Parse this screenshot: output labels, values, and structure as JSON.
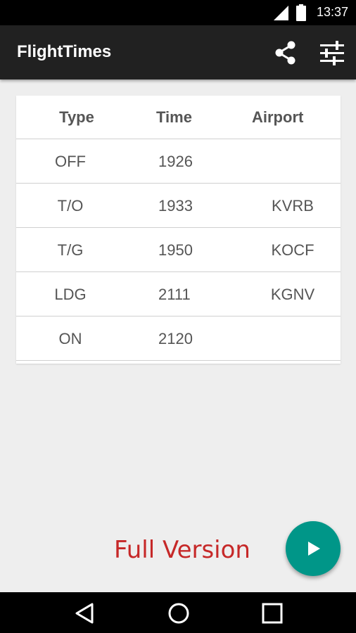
{
  "status_bar": {
    "time": "13:37"
  },
  "app_bar": {
    "title": "FlightTimes",
    "icons": [
      "share-icon",
      "tune-icon"
    ]
  },
  "table": {
    "headers": [
      "Type",
      "Time",
      "Airport"
    ],
    "rows": [
      [
        "OFF",
        "1926",
        ""
      ],
      [
        "T/O",
        "1933",
        "KVRB"
      ],
      [
        "T/G",
        "1950",
        "KOCF"
      ],
      [
        "LDG",
        "2111",
        "KGNV"
      ],
      [
        "ON",
        "2120",
        ""
      ]
    ]
  },
  "promo": {
    "label": "Full Version",
    "color": "#c62828"
  },
  "fab": {
    "icon": "play-icon",
    "color": "#009688"
  },
  "nav_bar": {
    "icons": [
      "back-icon",
      "home-icon",
      "recents-icon"
    ]
  }
}
